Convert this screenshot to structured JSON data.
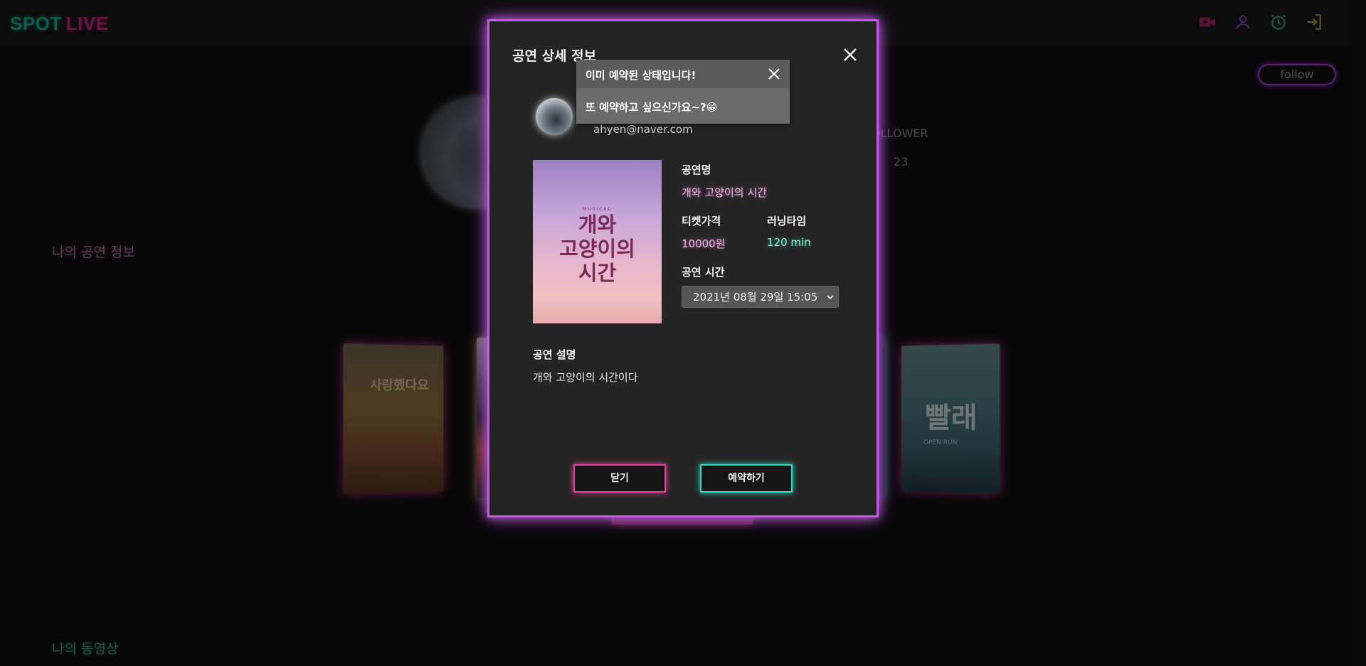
{
  "header": {
    "logo_spot": "SPOT",
    "logo_live": "LIVE",
    "icons": [
      "video-plus-icon",
      "user-icon",
      "alarm-icon",
      "login-icon"
    ],
    "colors": {
      "pink": "#c0247a",
      "purple": "#8e35c4",
      "teal": "#1aa88a",
      "gold": "#a9973a"
    }
  },
  "background": {
    "follow_label": "follow",
    "follower_label": "OLLOWER",
    "follower_count": "23",
    "my_shows_title": "나의 공연 정보",
    "my_videos_title": "나의 동영상",
    "poster_left_title": "사랑했다요",
    "poster_right_title": "빨래",
    "poster_right_sub": "OPEN RUN"
  },
  "modal": {
    "title": "공연 상세 정보",
    "host_email": "ahyen@naver.com",
    "poster_sub": "MUSICAL",
    "poster_title": "개와\n고양이의\n시간",
    "name_label": "공연명",
    "name_value": "개와 고양이의 시간",
    "price_label": "티켓가격",
    "price_value": "10000원",
    "runtime_label": "러닝타임",
    "runtime_value": "120 min",
    "time_label": "공연 시간",
    "time_selected": "2021년 08월 29일 15:05",
    "desc_label": "공연 설명",
    "desc_value": "개와 고양이의 시간이다",
    "close_button": "닫기",
    "reserve_button": "예약하기",
    "accent_color": "#c45ae8"
  },
  "toast": {
    "title": "이미 예약된 상태입니다!",
    "message": "또 예약하고 싶으신가요~?😁"
  }
}
